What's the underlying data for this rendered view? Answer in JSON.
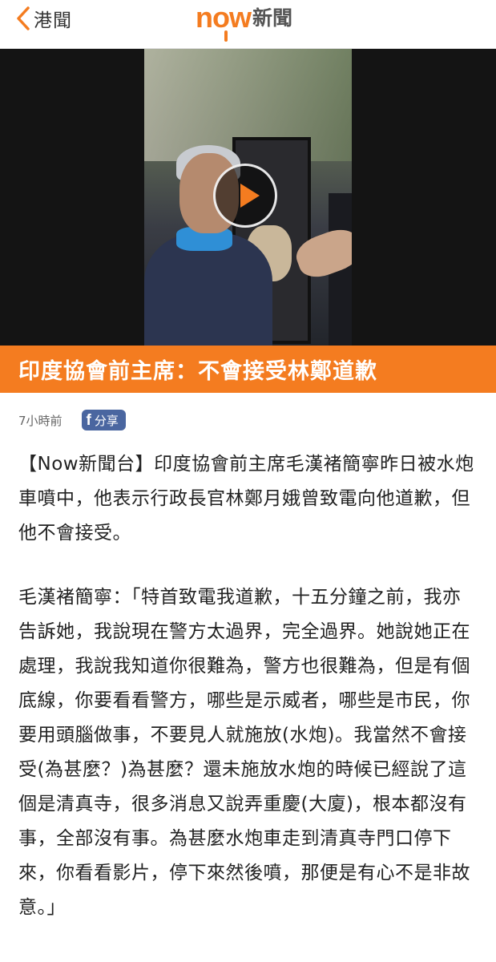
{
  "topbar": {
    "back_label": "港聞",
    "brand_now": "now",
    "brand_news": "新聞"
  },
  "video": {
    "play_icon": "play-icon"
  },
  "article": {
    "headline": "印度協會前主席：不會接受林鄭道歉",
    "time": "7小時前",
    "share_label": "分享",
    "share_icon": "facebook-icon",
    "paragraphs": [
      "【Now新聞台】印度協會前主席毛漢褚簡寧昨日被水炮車噴中，他表示行政長官林鄭月娥曾致電向他道歉，但他不會接受。",
      "毛漢褚簡寧：「特首致電我道歉，十五分鐘之前，我亦告訴她，我說現在警方太過界，完全過界。她說她正在處理，我說我知道你很難為，警方也很難為，但是有個底線，你要看看警方，哪些是示威者，哪些是市民，你要用頭腦做事，不要見人就施放(水炮)。我當然不會接受(為甚麼？)為甚麼？還未施放水炮的時候已經說了這個是清真寺，很多消息又說弄重慶(大廈)，根本都沒有事，全部沒有事。為甚麼水炮車走到清真寺門口停下來，你看看影片，停下來然後噴，那便是有心不是非故意。」"
    ]
  },
  "colors": {
    "accent": "#f47c20",
    "share_bg": "#4a66a0"
  }
}
